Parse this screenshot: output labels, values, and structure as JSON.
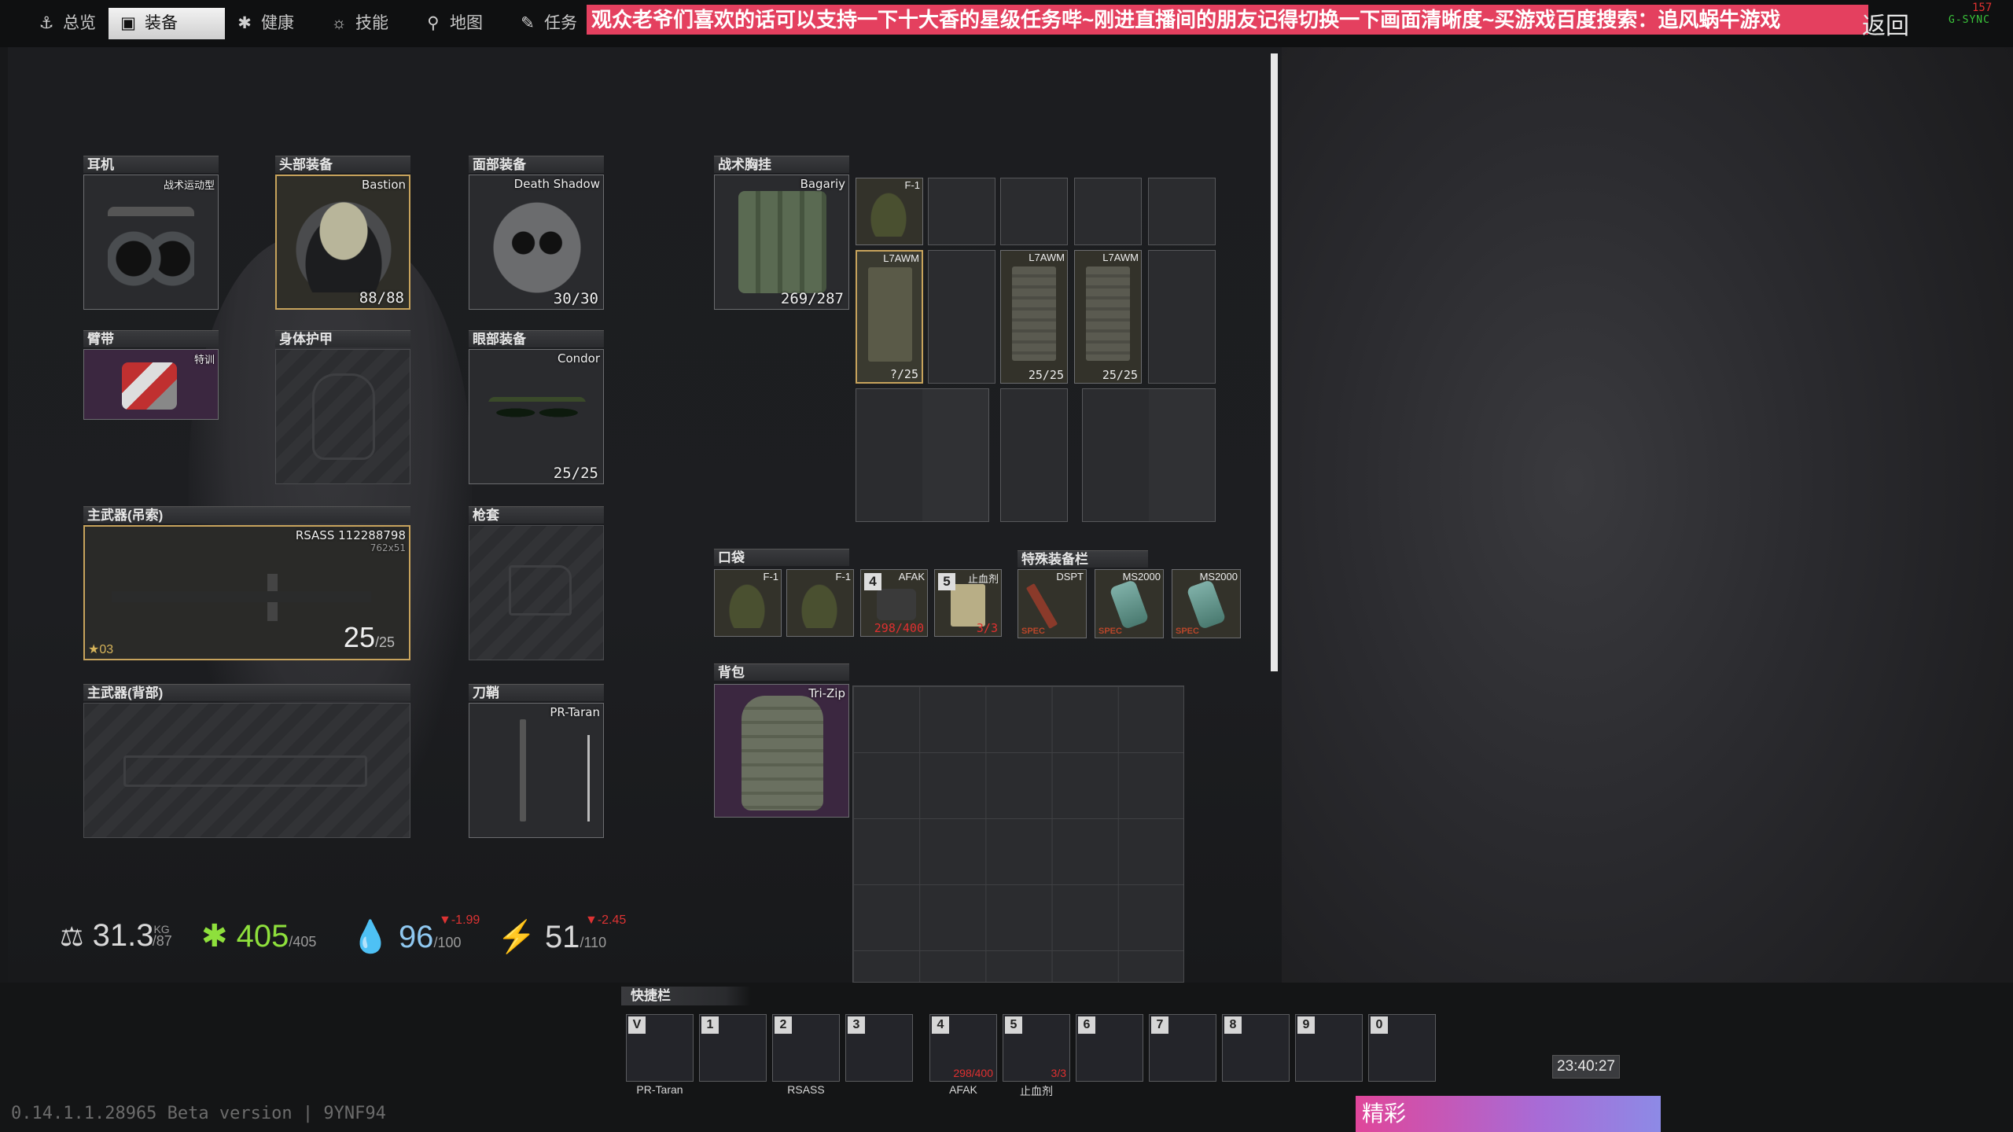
{
  "nav": {
    "tabs": [
      {
        "label": "总览",
        "icon": "anchor-icon"
      },
      {
        "label": "装备",
        "icon": "vest-icon",
        "active": true
      },
      {
        "label": "健康",
        "icon": "health-icon"
      },
      {
        "label": "技能",
        "icon": "skill-icon"
      },
      {
        "label": "地图",
        "icon": "map-pin-icon"
      },
      {
        "label": "任务",
        "icon": "task-icon"
      }
    ],
    "banner": "观众老爷们喜欢的话可以支持一下十大香的星级任务哔~刚进直播间的朋友记得切换一下画面清晰度~买游戏百度搜索：追风蜗牛游戏",
    "back": "返回",
    "gsync": "G-SYNC",
    "fps": "157"
  },
  "slots": {
    "earpiece": {
      "label": "耳机",
      "item": "战术运动型"
    },
    "headwear": {
      "label": "头部装备",
      "item": "Bastion",
      "durability": "88/88"
    },
    "faceCover": {
      "label": "面部装备",
      "item": "Death Shadow",
      "durability": "30/30"
    },
    "armband": {
      "label": "臂带",
      "item": "特训"
    },
    "bodyArmor": {
      "label": "身体护甲"
    },
    "eyewear": {
      "label": "眼部装备",
      "item": "Condor",
      "durability": "25/25"
    },
    "primarySling": {
      "label": "主武器(吊索)",
      "item": "RSASS 112288798",
      "caliber": "762x51",
      "ammo": "25",
      "ammoMax": "/25",
      "mark": "03"
    },
    "holster": {
      "label": "枪套"
    },
    "primaryBack": {
      "label": "主武器(背部)"
    },
    "scabbard": {
      "label": "刀鞘",
      "item": "PR-Taran"
    },
    "rig": {
      "label": "战术胸挂",
      "item": "Bagariy",
      "durability": "269/287"
    },
    "pockets": {
      "label": "口袋"
    },
    "special": {
      "label": "特殊装备栏"
    },
    "backpack": {
      "label": "背包",
      "item": "Tri-Zip"
    }
  },
  "rigItems": {
    "grenade": "F-1",
    "mag1": {
      "name": "L7AWM",
      "count": "?/25"
    },
    "mag2": {
      "name": "L7AWM",
      "count": "25/25"
    },
    "mag3": {
      "name": "L7AWM",
      "count": "25/25"
    }
  },
  "pocketItems": [
    {
      "name": "F-1"
    },
    {
      "name": "F-1"
    },
    {
      "name": "AFAK",
      "key": "4",
      "count": "298/400"
    },
    {
      "name": "止血剂",
      "key": "5",
      "count": "3/3"
    }
  ],
  "specialItems": [
    {
      "name": "DSPT",
      "spec": "SPEC"
    },
    {
      "name": "MS2000",
      "spec": "SPEC"
    },
    {
      "name": "MS2000",
      "spec": "SPEC"
    }
  ],
  "stats": {
    "weight": "31.3",
    "weightUnit": "KG",
    "weightMax": "/87",
    "health": "405",
    "healthMax": "/405",
    "hydration": "96",
    "hydrationMax": "/100",
    "hydrationDelta": "▼-1.99",
    "energy": "51",
    "energyMax": "/110",
    "energyDelta": "▼-2.45"
  },
  "quickbar": {
    "label": "快捷栏",
    "slots": [
      {
        "key": "V",
        "label": "PR-Taran"
      },
      {
        "key": "1",
        "label": ""
      },
      {
        "key": "2",
        "label": "RSASS"
      },
      {
        "key": "3",
        "label": ""
      },
      {
        "key": "4",
        "label": "AFAK",
        "count": "298/400"
      },
      {
        "key": "5",
        "label": "止血剂",
        "count": "3/3"
      },
      {
        "key": "6",
        "label": ""
      },
      {
        "key": "7",
        "label": ""
      },
      {
        "key": "8",
        "label": ""
      },
      {
        "key": "9",
        "label": ""
      },
      {
        "key": "0",
        "label": ""
      }
    ]
  },
  "footer": {
    "version": "0.14.1.1.28965 Beta version | 9YNF94",
    "clock": "23:40:27",
    "jingcai": "精彩"
  }
}
